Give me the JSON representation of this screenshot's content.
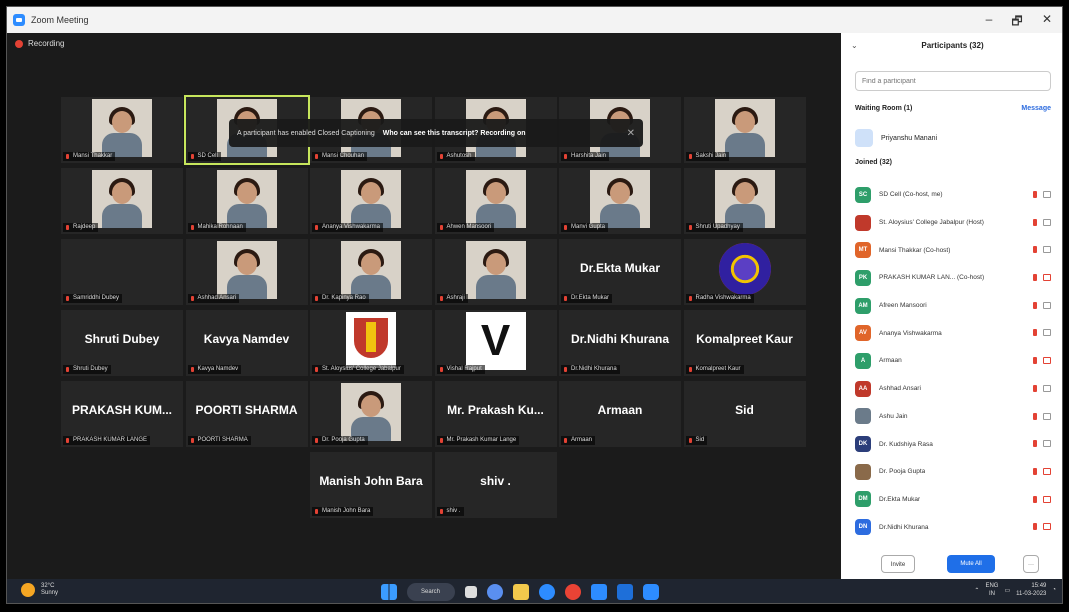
{
  "window": {
    "title": "Zoom Meeting",
    "controls": [
      "–",
      "🗗",
      "✕"
    ]
  },
  "recording": {
    "label": "Recording"
  },
  "banner": {
    "info": "A participant has enabled Closed Captioning",
    "question": "Who can see this transcript? Recording on",
    "close": "✕"
  },
  "tiles": [
    {
      "label": "Mansi Thakkar",
      "bigname": "",
      "kind": "video",
      "row": 0,
      "col": 0
    },
    {
      "label": "SD Cell",
      "bigname": "",
      "kind": "video",
      "row": 0,
      "col": 1,
      "active": true
    },
    {
      "label": "Mansi Chouhan",
      "bigname": "",
      "kind": "video",
      "row": 0,
      "col": 2
    },
    {
      "label": "Ashutosh",
      "bigname": "",
      "kind": "video",
      "row": 0,
      "col": 3
    },
    {
      "label": "Harshita Jain",
      "bigname": "",
      "kind": "video",
      "row": 0,
      "col": 4
    },
    {
      "label": "Sakshi Jain",
      "bigname": "",
      "kind": "video",
      "row": 0,
      "col": 5
    },
    {
      "label": "Rajdeep",
      "bigname": "",
      "kind": "video",
      "row": 1,
      "col": 0
    },
    {
      "label": "Mahika Rohnaan",
      "bigname": "",
      "kind": "video",
      "row": 1,
      "col": 1
    },
    {
      "label": "Ananya Vishwakarma",
      "bigname": "",
      "kind": "video",
      "row": 1,
      "col": 2
    },
    {
      "label": "Ahwen Mansoori",
      "bigname": "",
      "kind": "video",
      "row": 1,
      "col": 3
    },
    {
      "label": "Manvi Gupta",
      "bigname": "",
      "kind": "video",
      "row": 1,
      "col": 4
    },
    {
      "label": "Shruti Upadhyay",
      "bigname": "",
      "kind": "video",
      "row": 1,
      "col": 5
    },
    {
      "label": "Samriddhi Dubey",
      "bigname": "",
      "kind": "blank",
      "row": 2,
      "col": 0
    },
    {
      "label": "Ashhad Ansari",
      "bigname": "",
      "kind": "video",
      "row": 2,
      "col": 1
    },
    {
      "label": "Dr. Kapinya Rao",
      "bigname": "",
      "kind": "video",
      "row": 2,
      "col": 2
    },
    {
      "label": "Ashraji",
      "bigname": "",
      "kind": "video",
      "row": 2,
      "col": 3
    },
    {
      "label": "Dr.Ekta Mukar",
      "bigname": "Dr.Ekta Mukar",
      "kind": "name",
      "row": 2,
      "col": 4
    },
    {
      "label": "Radha Vishwakarma",
      "bigname": "",
      "kind": "logo",
      "row": 2,
      "col": 5
    },
    {
      "label": "Shruti Dubey",
      "bigname": "Shruti Dubey",
      "kind": "name",
      "row": 3,
      "col": 0
    },
    {
      "label": "Kavya Namdev",
      "bigname": "Kavya Namdev",
      "kind": "name",
      "row": 3,
      "col": 1
    },
    {
      "label": "St. Aloysius' College Jabalpur",
      "bigname": "",
      "kind": "crest",
      "row": 3,
      "col": 2
    },
    {
      "label": "Vishal Rajput",
      "bigname": "",
      "kind": "v",
      "row": 3,
      "col": 3
    },
    {
      "label": "Dr.Nidhi Khurana",
      "bigname": "Dr.Nidhi Khurana",
      "kind": "name",
      "row": 3,
      "col": 4
    },
    {
      "label": "Komalpreet Kaur",
      "bigname": "Komalpreet Kaur",
      "kind": "name",
      "row": 3,
      "col": 5
    },
    {
      "label": "PRAKASH KUMAR LANGE",
      "bigname": "PRAKASH KUM...",
      "kind": "name",
      "row": 4,
      "col": 0
    },
    {
      "label": "POORTI SHARMA",
      "bigname": "POORTI SHARMA",
      "kind": "name",
      "row": 4,
      "col": 1
    },
    {
      "label": "Dr. Pooja Gupta",
      "bigname": "",
      "kind": "video",
      "row": 4,
      "col": 2
    },
    {
      "label": "Mr. Prakash Kumar Lange",
      "bigname": "Mr. Prakash Ku...",
      "kind": "name",
      "row": 4,
      "col": 3
    },
    {
      "label": "Armaan",
      "bigname": "Armaan",
      "kind": "name",
      "row": 4,
      "col": 4
    },
    {
      "label": "Sid",
      "bigname": "Sid",
      "kind": "name",
      "row": 4,
      "col": 5
    },
    {
      "label": "Manish John Bara",
      "bigname": "Manish John Bara",
      "kind": "name",
      "row": 5,
      "col": 2
    },
    {
      "label": "shiv .",
      "bigname": "shiv .",
      "kind": "name",
      "row": 5,
      "col": 3
    }
  ],
  "panel": {
    "title": "Participants (32)",
    "search_placeholder": "Find a participant",
    "waiting_room": "Waiting Room (1)",
    "message": "Message",
    "waiting_person": "Priyanshu Manani",
    "joined": "Joined (32)",
    "participants": [
      {
        "initials": "SC",
        "name": "SD Cell (Co-host, me)",
        "color": "#2e9e6a",
        "cam_off": false
      },
      {
        "initials": "",
        "name": "St. Aloysius' College Jabalpur (Host)",
        "color": "#c0392b",
        "cam_off": false
      },
      {
        "initials": "MT",
        "name": "Mansi Thakkar (Co-host)",
        "color": "#e0652a",
        "cam_off": false
      },
      {
        "initials": "PK",
        "name": "PRAKASH KUMAR LAN... (Co-host)",
        "color": "#2e9e6a",
        "cam_off": true
      },
      {
        "initials": "AM",
        "name": "Afreen Mansoori",
        "color": "#2e9e6a",
        "cam_off": false
      },
      {
        "initials": "AV",
        "name": "Ananya Vishwakarma",
        "color": "#e0652a",
        "cam_off": false
      },
      {
        "initials": "A",
        "name": "Armaan",
        "color": "#2e9e6a",
        "cam_off": true
      },
      {
        "initials": "AA",
        "name": "Ashhad Ansari",
        "color": "#c0392b",
        "cam_off": false
      },
      {
        "initials": "",
        "name": "Ashu Jain",
        "color": "#6b7b8a",
        "cam_off": false
      },
      {
        "initials": "DK",
        "name": "Dr. Kudshiya Rasa",
        "color": "#2c3e7a",
        "cam_off": false
      },
      {
        "initials": "",
        "name": "Dr. Pooja Gupta",
        "color": "#8a6a4a",
        "cam_off": true
      },
      {
        "initials": "DM",
        "name": "Dr.Ekta Mukar",
        "color": "#2e9e6a",
        "cam_off": true
      },
      {
        "initials": "DN",
        "name": "Dr.Nidhi Khurana",
        "color": "#2d6cdf",
        "cam_off": true
      }
    ],
    "invite": "Invite",
    "mute_all": "Mute All",
    "more": "···"
  },
  "taskbar": {
    "temp": "32°C",
    "weather": "Sunny",
    "search": "Search",
    "lang": "ENG",
    "region": "IN",
    "time": "15:49",
    "date": "11-03-2023"
  }
}
